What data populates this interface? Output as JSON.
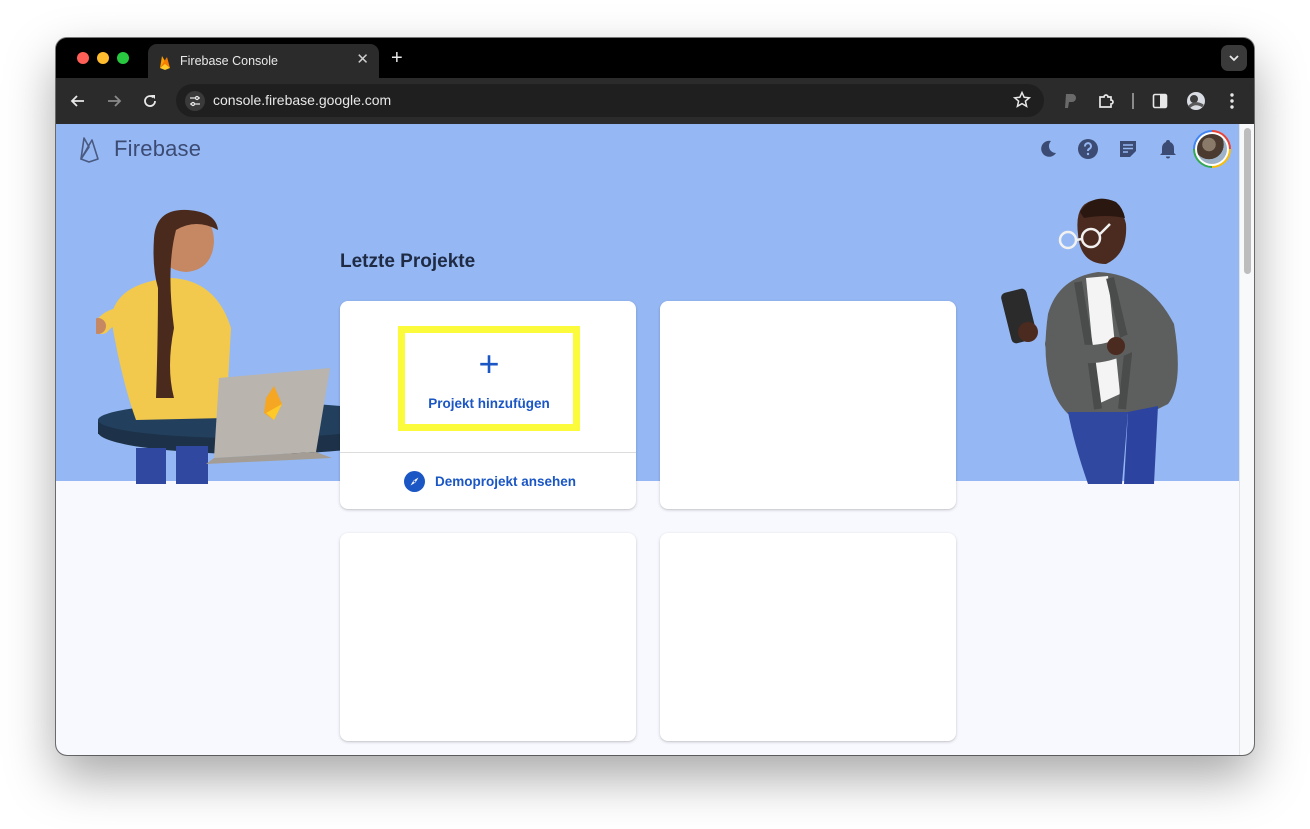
{
  "browser": {
    "tab_title": "Firebase Console",
    "tab_close": "✕",
    "new_tab": "+",
    "url": "console.firebase.google.com"
  },
  "header": {
    "brand": "Firebase",
    "icons": [
      "dark-mode-icon",
      "help-icon",
      "release-notes-icon",
      "notifications-icon"
    ]
  },
  "main": {
    "section_title": "Letzte Projekte",
    "add_project": {
      "plus": "+",
      "label": "Projekt hinzufügen"
    },
    "demo_project": {
      "label": "Demoprojekt ansehen"
    }
  },
  "colors": {
    "hero": "#95b8f4",
    "accent": "#1a56c4",
    "highlight": "#fbfb3b"
  }
}
